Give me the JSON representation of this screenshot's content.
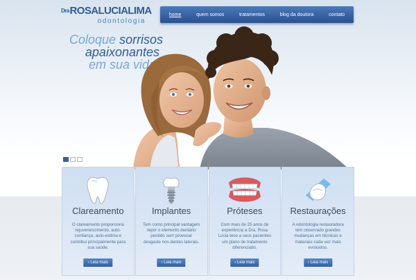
{
  "logo": {
    "prefix": "Dra",
    "name": "ROSALUCIALIMA",
    "sub": "odontologia"
  },
  "nav": {
    "items": [
      {
        "label": "home",
        "active": true
      },
      {
        "label": "quem somos",
        "active": false
      },
      {
        "label": "tratamentos",
        "active": false
      },
      {
        "label": "blog da doutora",
        "active": false
      },
      {
        "label": "contato",
        "active": false
      }
    ]
  },
  "tagline": {
    "line1_a": "Coloque ",
    "line1_b": "sorrisos",
    "line2": "apaixonantes",
    "line3": "em sua vida."
  },
  "slider": {
    "count": 3,
    "active_index": 0
  },
  "cards": [
    {
      "icon": "tooth-icon",
      "title": "Clareamento",
      "text": "O clareamento proporciona rejuvenescimento, auto-confiança, auto-estima e contribui principalmente para sua saúde.",
      "button": "› Leia mais"
    },
    {
      "icon": "implant-icon",
      "title": "Implantes",
      "text": "Tem como principal vantagem repor o elemento dentário perdido sem provocar desgaste nos dentes laterais.",
      "button": "› Leia mais"
    },
    {
      "icon": "denture-icon",
      "title": "Próteses",
      "text": "Com mais de 25 anos de experiência a Dra. Rosa Lúcia tece a seus pacientes um plano de tratamento diferenciado.",
      "button": "› Leia mais"
    },
    {
      "icon": "restoration-icon",
      "title": "Restaurações",
      "text": "A odontologia restauradora tem observado grandes mudanças em técnicas e materiais cada vez mais evoluídos.",
      "button": "› Leia mais"
    }
  ],
  "colors": {
    "brand_blue": "#2f5d96",
    "nav_blue": "#3a65a6",
    "card_bg": "#d6e4f4"
  }
}
